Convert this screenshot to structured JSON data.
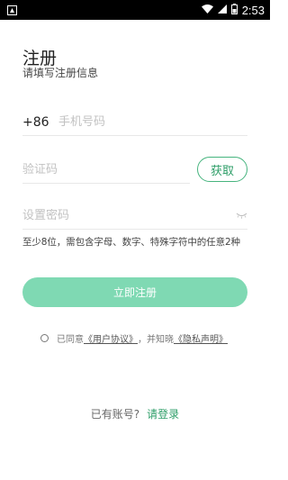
{
  "status_bar": {
    "app_icon": "app-notification-icon",
    "time": "2:53",
    "icons": [
      "wifi-icon",
      "signal-icon",
      "battery-icon"
    ]
  },
  "header": {
    "title": "注册",
    "subtitle": "请填写注册信息"
  },
  "form": {
    "phone": {
      "prefix": "+86",
      "placeholder": "手机号码",
      "value": ""
    },
    "code": {
      "placeholder": "验证码",
      "value": "",
      "button_label": "获取"
    },
    "password": {
      "placeholder": "设置密码",
      "value": "",
      "toggle_icon": "eye-closed-icon"
    },
    "password_hint": "至少8位，需包含字母、数字、特殊字符中的任意2种"
  },
  "register_button": {
    "label": "立即注册"
  },
  "agreement": {
    "prefix": "已同意",
    "user_agreement": "《用户协议》",
    "middle": "，并知晓",
    "privacy_policy": "《隐私声明》",
    "checked": false
  },
  "login": {
    "prefix": "已有账号?",
    "link": "请登录"
  },
  "colors": {
    "accent": "#2e9e68",
    "button_bg": "#7fd9b3",
    "placeholder": "#c2c2c2",
    "divider": "#e8e8e8"
  }
}
